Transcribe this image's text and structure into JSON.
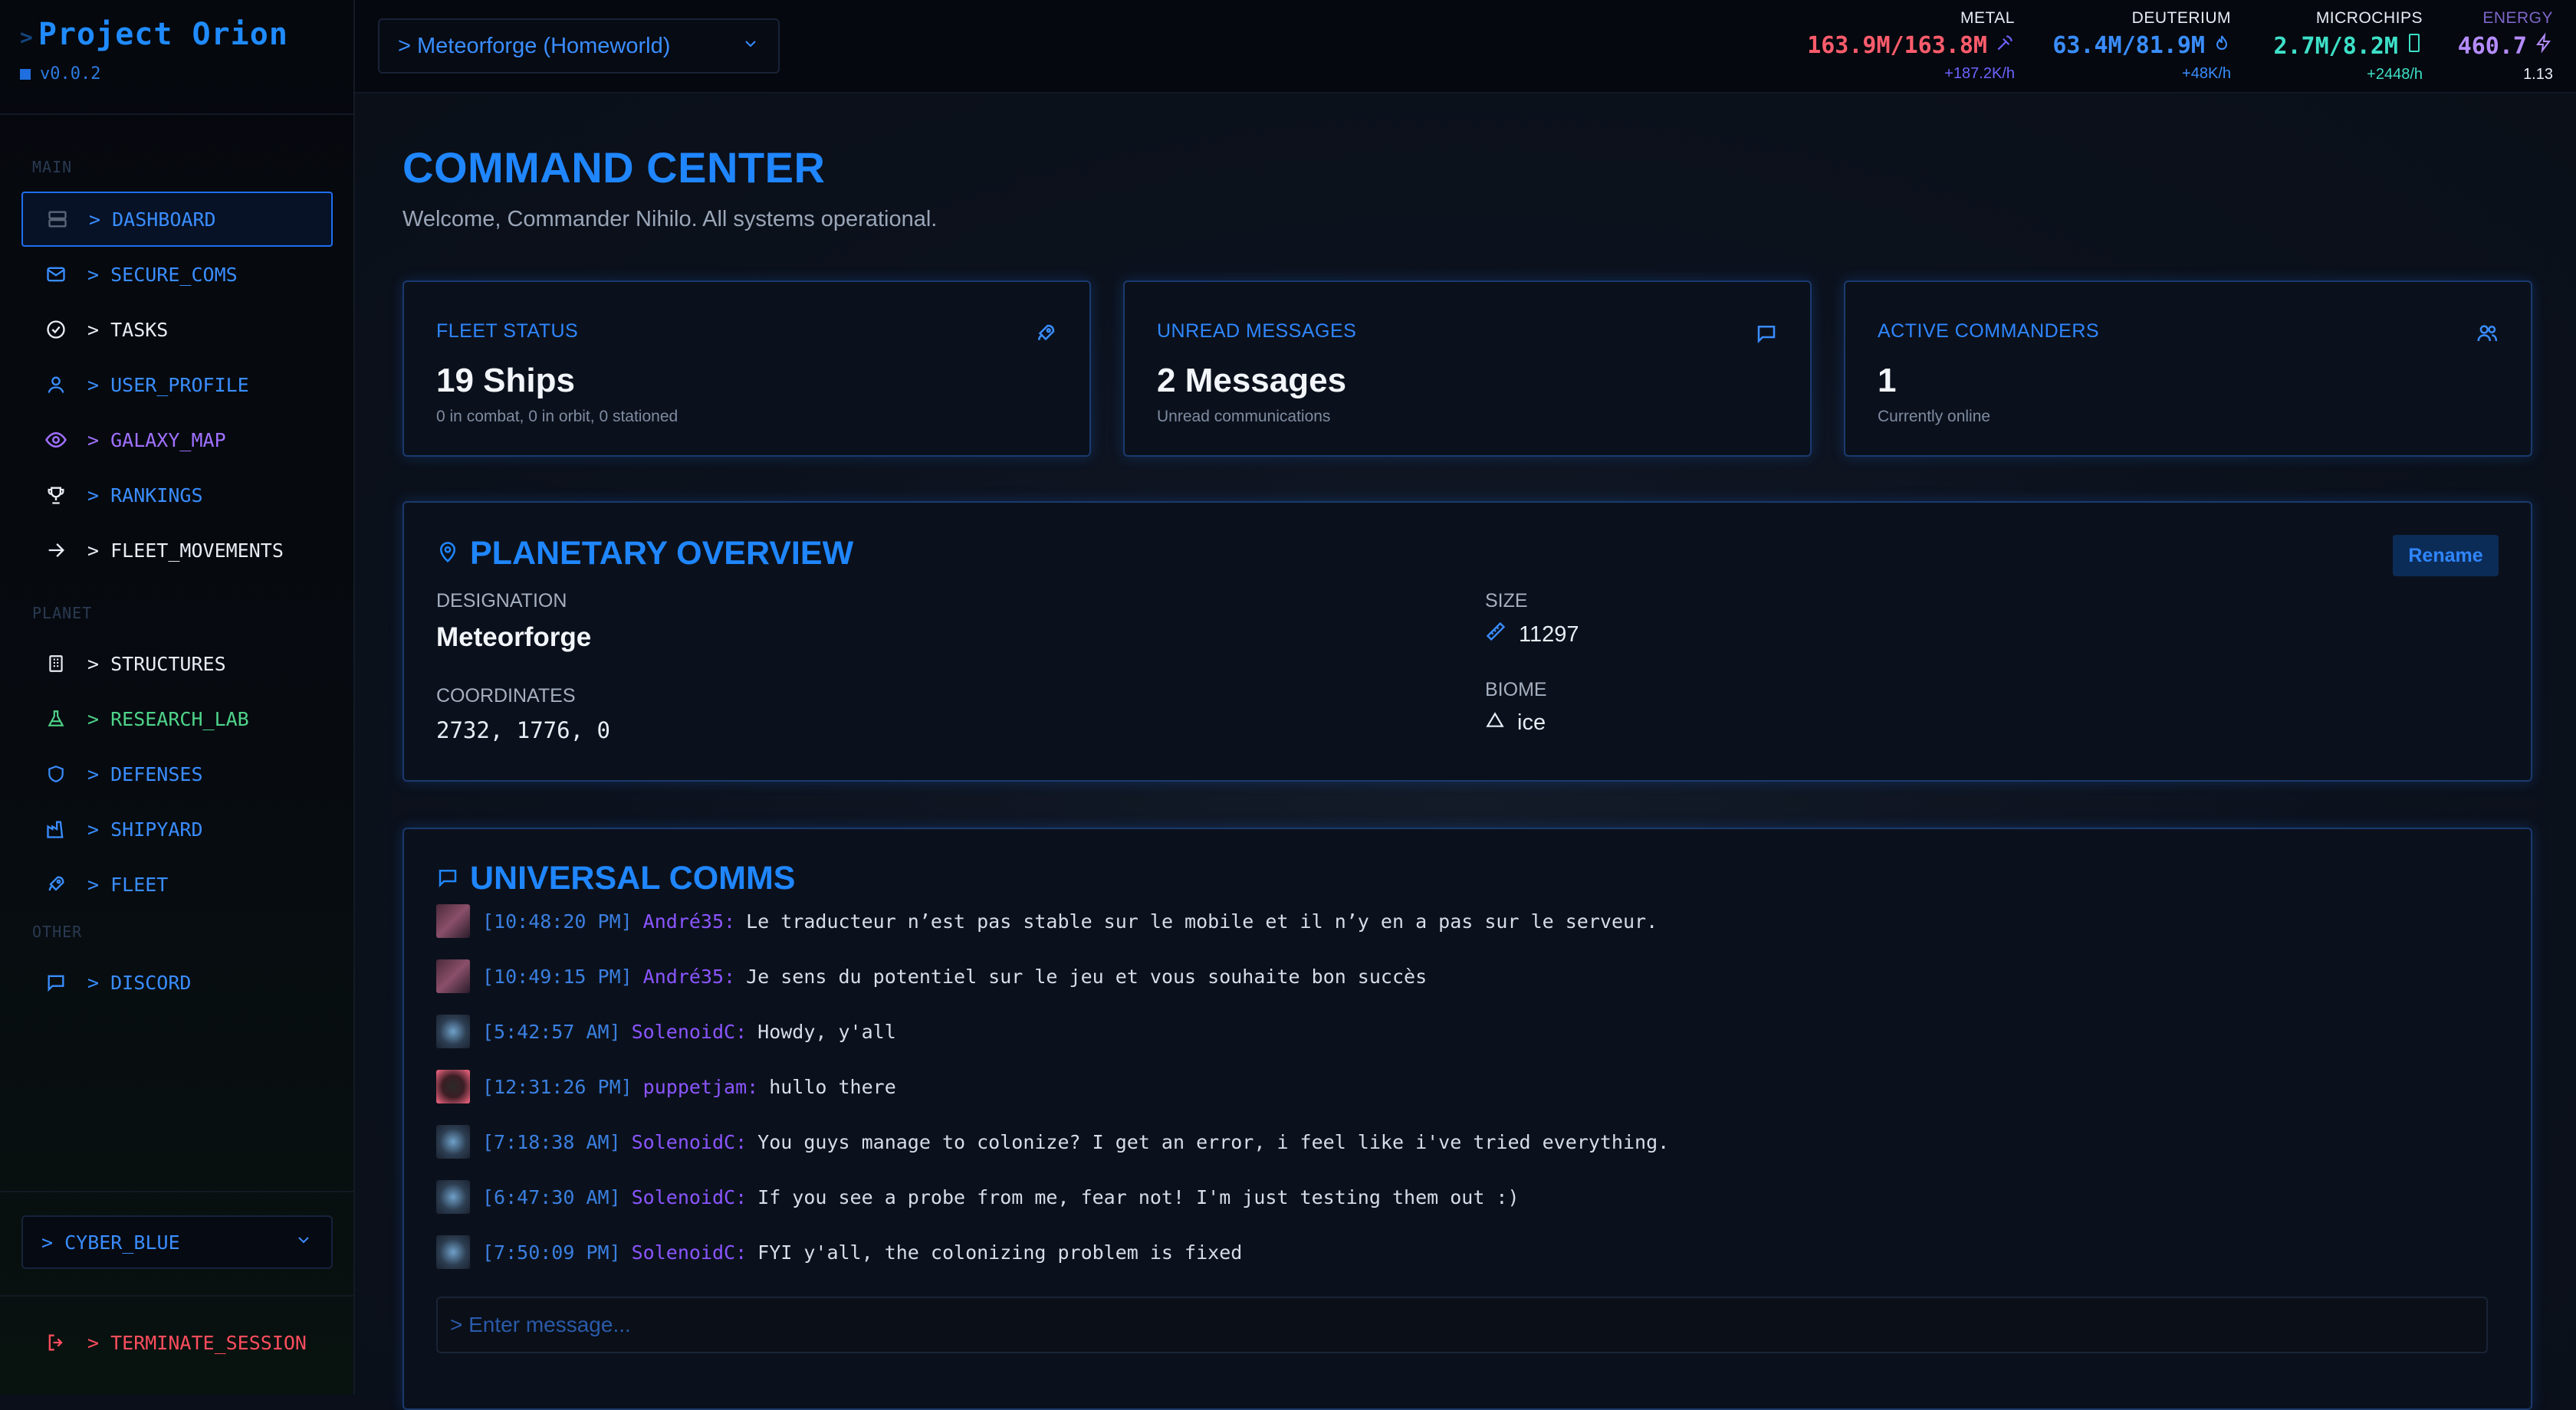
{
  "app": {
    "title": "Project Orion",
    "version": "v0.0.2"
  },
  "sidebar": {
    "sections": {
      "main": "MAIN",
      "planet": "PLANET",
      "other": "OTHER"
    },
    "items": [
      {
        "label": "> DASHBOARD",
        "icon": "server-icon"
      },
      {
        "label": "> SECURE_COMS",
        "icon": "mail-icon"
      },
      {
        "label": "> TASKS",
        "icon": "check-circle-icon"
      },
      {
        "label": "> USER_PROFILE",
        "icon": "user-icon"
      },
      {
        "label": "> GALAXY_MAP",
        "icon": "eye-icon"
      },
      {
        "label": "> RANKINGS",
        "icon": "trophy-icon"
      },
      {
        "label": "> FLEET_MOVEMENTS",
        "icon": "arrow-right-icon"
      },
      {
        "label": "> STRUCTURES",
        "icon": "building-icon"
      },
      {
        "label": "> RESEARCH_LAB",
        "icon": "flask-icon"
      },
      {
        "label": "> DEFENSES",
        "icon": "shield-icon"
      },
      {
        "label": "> SHIPYARD",
        "icon": "factory-icon"
      },
      {
        "label": "> FLEET",
        "icon": "rocket-icon"
      },
      {
        "label": "> DISCORD",
        "icon": "chat-icon"
      }
    ],
    "theme": "> CYBER_BLUE",
    "logout": "> TERMINATE_SESSION"
  },
  "topbar": {
    "planet": "> Meteorforge (Homeworld)",
    "resources": [
      {
        "label": "METAL",
        "value": "163.9M/163.8M",
        "rate": "+187.2K/h",
        "icon": "pickaxe-icon",
        "color": "#ff5c6c"
      },
      {
        "label": "DEUTERIUM",
        "value": "63.4M/81.9M",
        "rate": "+48K/h",
        "icon": "flame-icon",
        "color": "#3a8dff"
      },
      {
        "label": "MICROCHIPS",
        "value": "2.7M/8.2M",
        "rate": "+2448/h",
        "icon": "chip-icon",
        "color": "#3de0c8"
      },
      {
        "label": "ENERGY",
        "value": "460.7",
        "rate": "1.13",
        "icon": "bolt-icon",
        "color": "#b48cff"
      }
    ]
  },
  "main": {
    "title": "COMMAND CENTER",
    "welcome": "Welcome, Commander Nihilo. All systems operational.",
    "stats": [
      {
        "title": "FLEET STATUS",
        "value": "19 Ships",
        "sub": "0 in combat, 0 in orbit, 0 stationed",
        "icon": "rocket-icon"
      },
      {
        "title": "UNREAD MESSAGES",
        "value": "2 Messages",
        "sub": "Unread communications",
        "icon": "chat-icon"
      },
      {
        "title": "ACTIVE COMMANDERS",
        "value": "1",
        "sub": "Currently online",
        "icon": "users-icon"
      }
    ],
    "planet": {
      "title": "PLANETARY OVERVIEW",
      "rename": "Rename",
      "designation_label": "DESIGNATION",
      "designation": "Meteorforge",
      "coordinates_label": "COORDINATES",
      "coordinates": "2732, 1776, 0",
      "size_label": "SIZE",
      "size": "11297",
      "biome_label": "BIOME",
      "biome": "ice"
    },
    "comms": {
      "title": "UNIVERSAL COMMS",
      "placeholder": "> Enter message...",
      "messages": [
        {
          "time": "[10:48:20 PM]",
          "user": "André35:",
          "text": "Le traducteur n’est pas stable sur le mobile et il n’y en a pas sur le serveur."
        },
        {
          "time": "[10:49:15 PM]",
          "user": "André35:",
          "text": "Je sens du potentiel sur le jeu et vous souhaite bon succès"
        },
        {
          "time": "[5:42:57 AM]",
          "user": "SolenoidC:",
          "text": "Howdy, y'all"
        },
        {
          "time": "[12:31:26 PM]",
          "user": "puppetjam:",
          "text": "hullo there"
        },
        {
          "time": "[7:18:38 AM]",
          "user": "SolenoidC:",
          "text": "You guys manage to colonize? I get an error, i feel like i've tried everything."
        },
        {
          "time": "[6:47:30 AM]",
          "user": "SolenoidC:",
          "text": "If you see a probe from me, fear not! I'm just testing them out :)"
        },
        {
          "time": "[7:50:09 PM]",
          "user": "SolenoidC:",
          "text": "FYI y'all, the colonizing problem is fixed"
        }
      ]
    }
  }
}
